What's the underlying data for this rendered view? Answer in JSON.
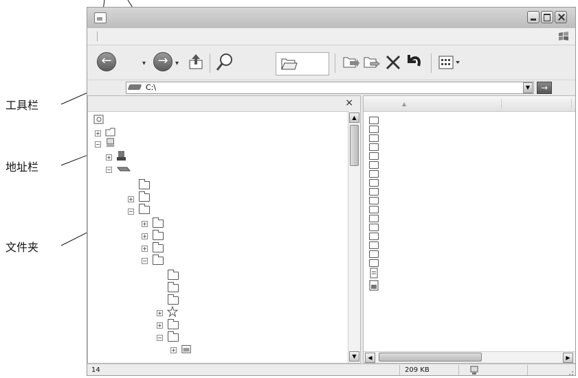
{
  "annotations": {
    "toolbar_label": "工具栏",
    "addressbar_label": "地址栏",
    "folder_label": "文件夹"
  },
  "window": {
    "icons": [
      "back-arrow-icon",
      "forward-arrow-icon",
      "up-folder-icon",
      "search-icon",
      "folders-icon",
      "move-to-icon",
      "copy-to-icon",
      "delete-icon",
      "undo-icon",
      "views-icon"
    ]
  },
  "address": {
    "value": "C:\\"
  },
  "left_pane": {
    "close_glyph": "×"
  },
  "status": {
    "count": "14",
    "size": "209 KB"
  }
}
